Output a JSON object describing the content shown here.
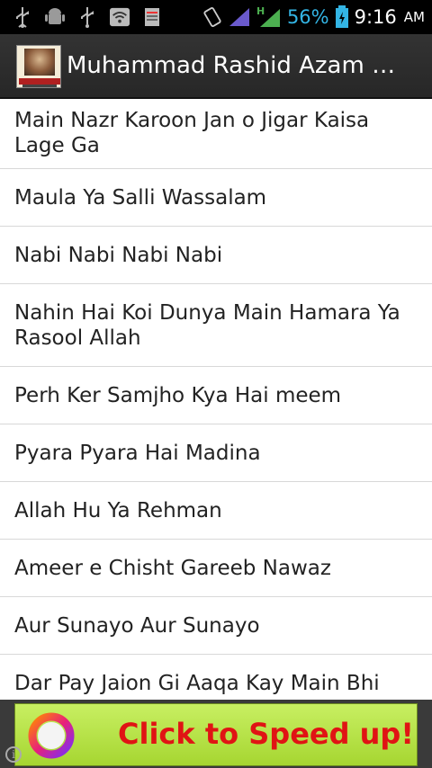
{
  "status_bar": {
    "battery_percent": "56%",
    "time": "9:16",
    "ampm": "AM",
    "left_icons": [
      "usb-icon",
      "android-icon",
      "usb-icon",
      "wifi-icon",
      "storage-icon"
    ],
    "right_icons": [
      "vibrate-icon",
      "signal-icon",
      "data-signal-icon",
      "battery-charging-icon"
    ],
    "network_label": "H",
    "colors": {
      "accent": "#33b5e5",
      "signal": "#6a5acd"
    }
  },
  "action_bar": {
    "title": "Muhammad Rashid Azam Na…",
    "icon": "app-logo-icon"
  },
  "list": {
    "items": [
      {
        "label": "Main Nazr Karoon Jan o Jigar Kaisa Lage Ga"
      },
      {
        "label": "Maula Ya Salli Wassalam"
      },
      {
        "label": "Nabi Nabi Nabi Nabi"
      },
      {
        "label": "Nahin Hai Koi Dunya Main Hamara Ya Rasool Allah"
      },
      {
        "label": "Perh Ker Samjho Kya Hai meem"
      },
      {
        "label": "Pyara Pyara Hai Madina"
      },
      {
        "label": "Allah Hu Ya Rehman"
      },
      {
        "label": "Ameer e Chisht Gareeb Nawaz"
      },
      {
        "label": "Aur Sunayo Aur Sunayo"
      },
      {
        "label": "Dar Pay Jaion Gi Aaqa Kay Main Bhi"
      }
    ]
  },
  "ad": {
    "text": "Click to Speed up!",
    "info_icon": "info-icon",
    "colors": {
      "background": "#b7e34a",
      "text": "#e01414"
    }
  }
}
